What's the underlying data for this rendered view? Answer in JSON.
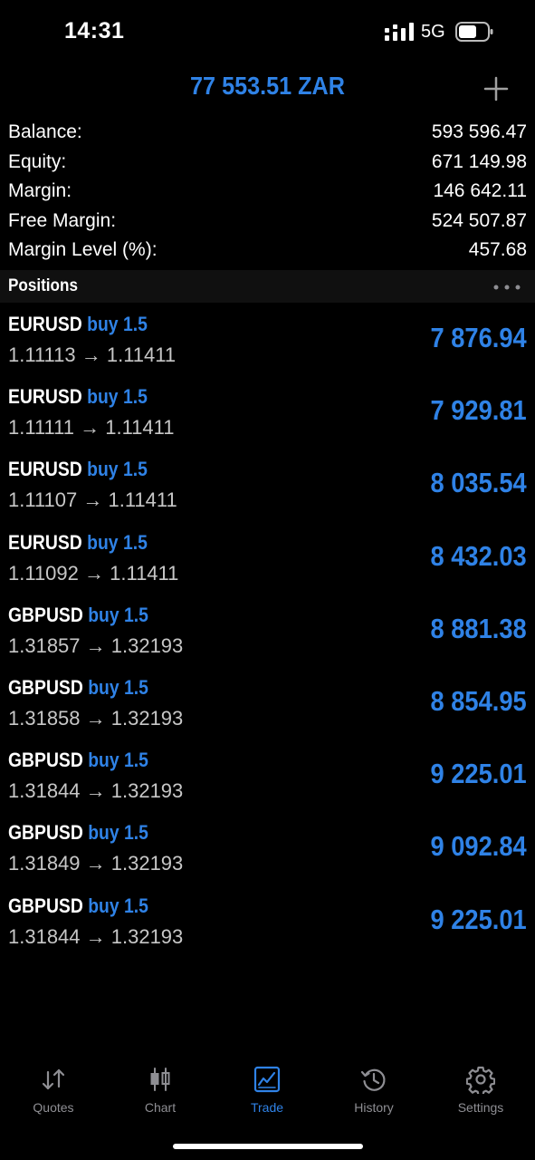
{
  "status_bar": {
    "time": "14:31",
    "network": "5G"
  },
  "header": {
    "title": "77 553.51 ZAR"
  },
  "summary": [
    {
      "label": "Balance:",
      "value": "593 596.47"
    },
    {
      "label": "Equity:",
      "value": "671 149.98"
    },
    {
      "label": "Margin:",
      "value": "146 642.11"
    },
    {
      "label": "Free Margin:",
      "value": "524 507.87"
    },
    {
      "label": "Margin Level (%):",
      "value": "457.68"
    }
  ],
  "positions": {
    "title": "Positions",
    "items": [
      {
        "symbol": "EURUSD",
        "side": "buy 1.5",
        "prices": "1.11113 → 1.11411",
        "profit": "7 876.94"
      },
      {
        "symbol": "EURUSD",
        "side": "buy 1.5",
        "prices": "1.11111 → 1.11411",
        "profit": "7 929.81"
      },
      {
        "symbol": "EURUSD",
        "side": "buy 1.5",
        "prices": "1.11107 → 1.11411",
        "profit": "8 035.54"
      },
      {
        "symbol": "EURUSD",
        "side": "buy 1.5",
        "prices": "1.11092 → 1.11411",
        "profit": "8 432.03"
      },
      {
        "symbol": "GBPUSD",
        "side": "buy 1.5",
        "prices": "1.31857 → 1.32193",
        "profit": "8 881.38"
      },
      {
        "symbol": "GBPUSD",
        "side": "buy 1.5",
        "prices": "1.31858 → 1.32193",
        "profit": "8 854.95"
      },
      {
        "symbol": "GBPUSD",
        "side": "buy 1.5",
        "prices": "1.31844 → 1.32193",
        "profit": "9 225.01"
      },
      {
        "symbol": "GBPUSD",
        "side": "buy 1.5",
        "prices": "1.31849 → 1.32193",
        "profit": "9 092.84"
      },
      {
        "symbol": "GBPUSD",
        "side": "buy 1.5",
        "prices": "1.31844 → 1.32193",
        "profit": "9 225.01"
      }
    ]
  },
  "tabs": [
    {
      "label": "Quotes",
      "icon": "quotes-arrows-icon"
    },
    {
      "label": "Chart",
      "icon": "candlestick-icon"
    },
    {
      "label": "Trade",
      "icon": "trade-chart-icon",
      "active": true
    },
    {
      "label": "History",
      "icon": "history-clock-icon"
    },
    {
      "label": "Settings",
      "icon": "gear-icon"
    }
  ],
  "colors": {
    "accent": "#2f82e6",
    "background": "#000000",
    "inactive": "#8e8e93"
  }
}
